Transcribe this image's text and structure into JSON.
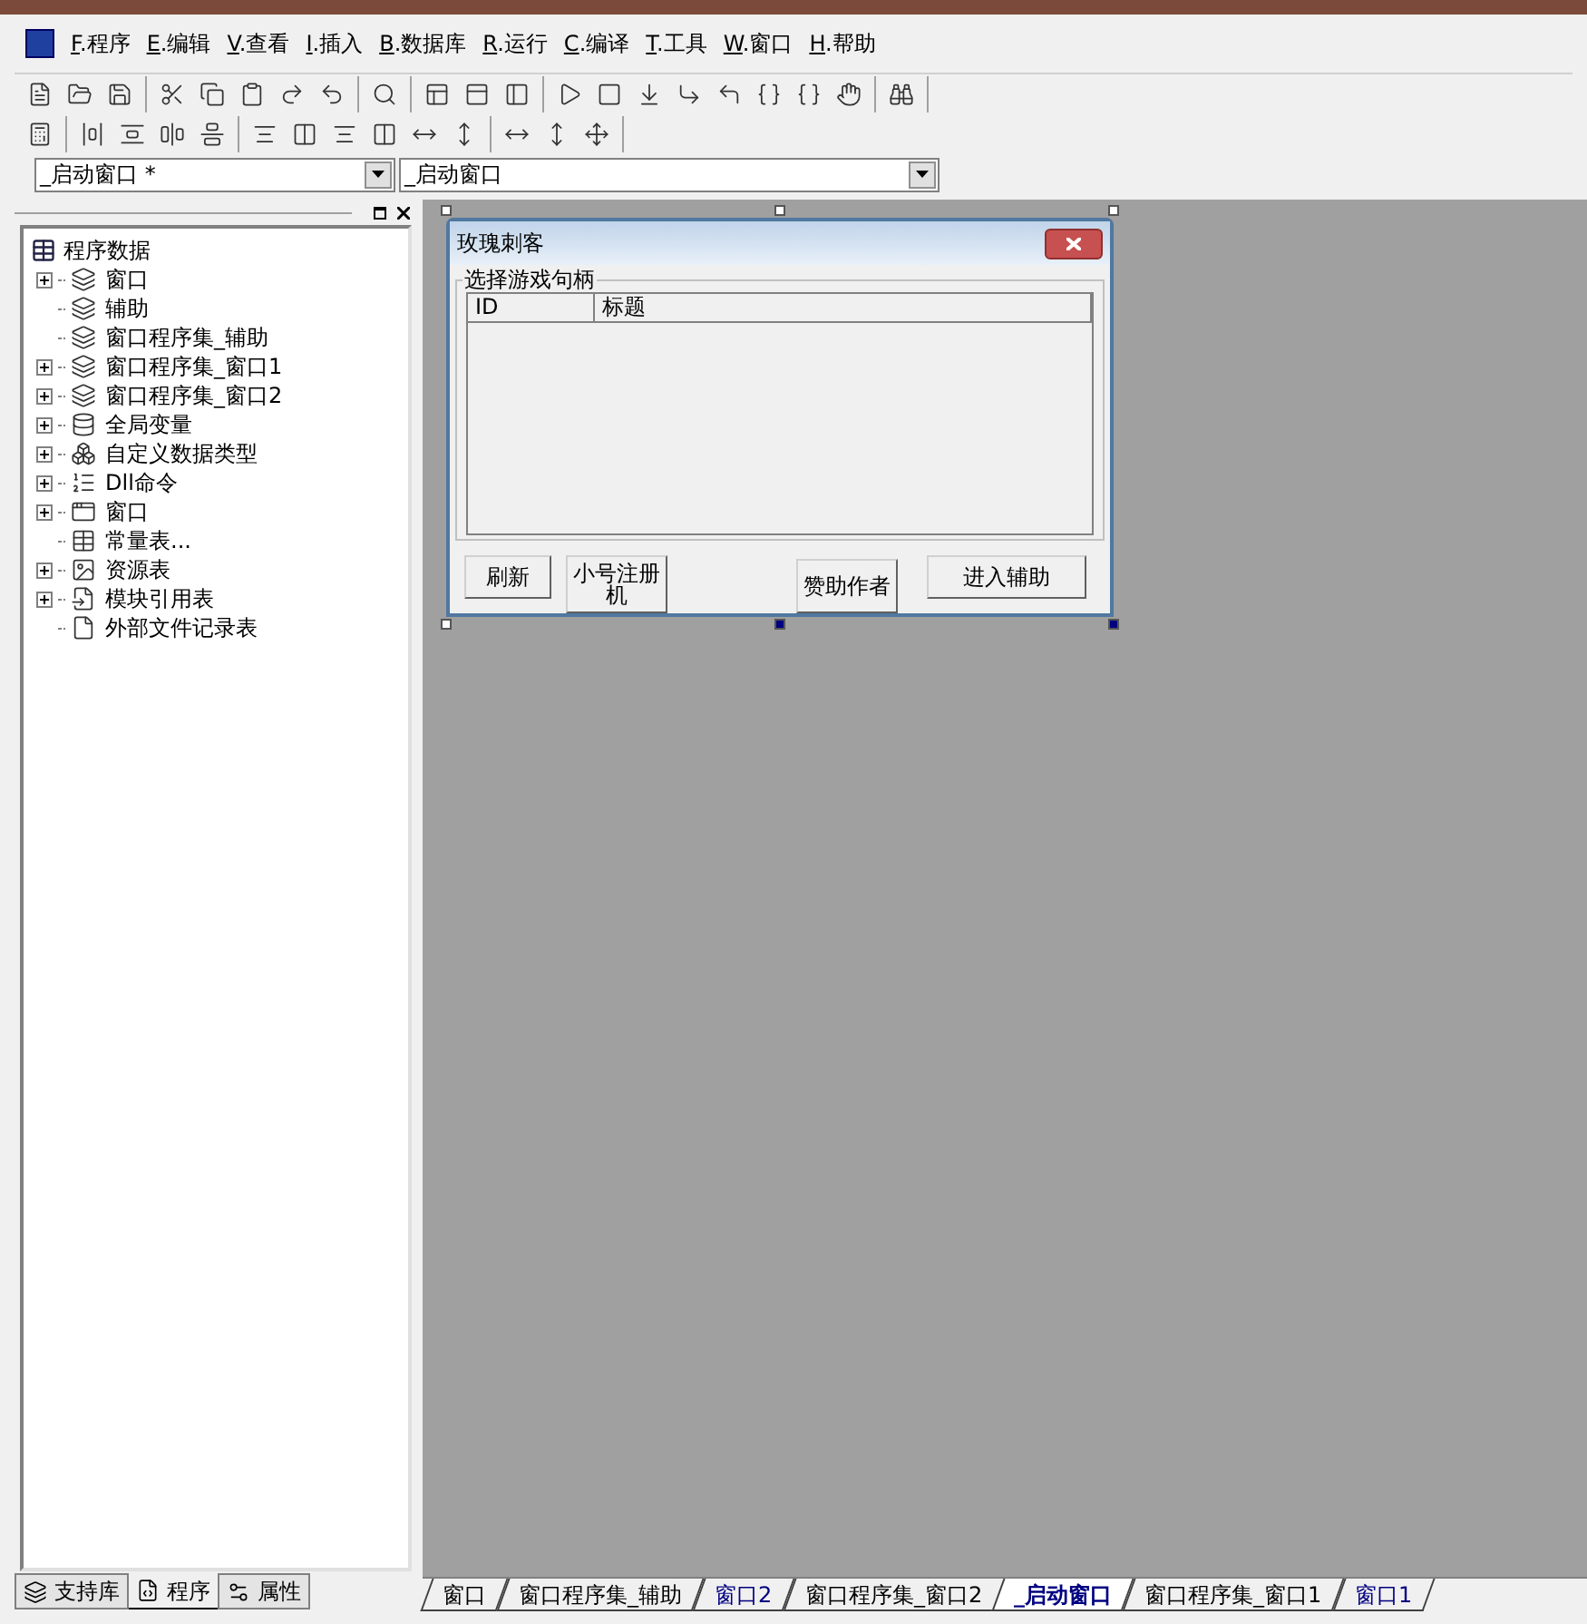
{
  "menu": [
    {
      "key": "F",
      "label": ".程序"
    },
    {
      "key": "E",
      "label": ".编辑"
    },
    {
      "key": "V",
      "label": ".查看"
    },
    {
      "key": "I",
      "label": ".插入"
    },
    {
      "key": "B",
      "label": ".数据库"
    },
    {
      "key": "R",
      "label": ".运行"
    },
    {
      "key": "C",
      "label": ".编译"
    },
    {
      "key": "T",
      "label": ".工具"
    },
    {
      "key": "W",
      "label": ".窗口"
    },
    {
      "key": "H",
      "label": ".帮助"
    }
  ],
  "selectors": [
    {
      "value": "_启动窗口 *"
    },
    {
      "value": "_启动窗口"
    }
  ],
  "tree": {
    "root": "程序数据",
    "items": [
      {
        "label": "窗口",
        "kind": "group"
      },
      {
        "label": "辅助",
        "kind": "leaf"
      },
      {
        "label": "窗口程序集_辅助",
        "kind": "leaf"
      },
      {
        "label": "窗口程序集_窗口1",
        "kind": "group"
      },
      {
        "label": "窗口程序集_窗口2",
        "kind": "group"
      },
      {
        "label": "全局变量",
        "kind": "group"
      },
      {
        "label": "自定义数据类型",
        "kind": "group"
      },
      {
        "label": "Dll命令",
        "kind": "group"
      },
      {
        "label": "窗口",
        "kind": "group"
      },
      {
        "label": "常量表...",
        "kind": "leaf"
      },
      {
        "label": "资源表",
        "kind": "group"
      },
      {
        "label": "模块引用表",
        "kind": "group"
      },
      {
        "label": "外部文件记录表",
        "kind": "leaf"
      }
    ]
  },
  "panel_tabs": [
    {
      "label": "支持库",
      "selected": false
    },
    {
      "label": "程序",
      "selected": true
    },
    {
      "label": "属性",
      "selected": false
    }
  ],
  "form": {
    "title": "玫瑰刺客",
    "group_label": "选择游戏句柄",
    "columns": [
      "ID",
      "标题"
    ],
    "buttons": [
      {
        "label": "刷新"
      },
      {
        "label": "小号注册机"
      },
      {
        "label": "赞助作者"
      },
      {
        "label": "进入辅助"
      }
    ]
  },
  "doc_tabs": [
    {
      "label": "窗口",
      "selected": false,
      "color": "#000000"
    },
    {
      "label": "窗口程序集_辅助",
      "selected": false,
      "color": "#000000"
    },
    {
      "label": "窗口2",
      "selected": false,
      "color": "#000080"
    },
    {
      "label": "窗口程序集_窗口2",
      "selected": false,
      "color": "#000000"
    },
    {
      "label": "_启动窗口",
      "selected": true,
      "color": "#000080"
    },
    {
      "label": "窗口程序集_窗口1",
      "selected": false,
      "color": "#000000"
    },
    {
      "label": "窗口1",
      "selected": false,
      "color": "#000080"
    }
  ]
}
